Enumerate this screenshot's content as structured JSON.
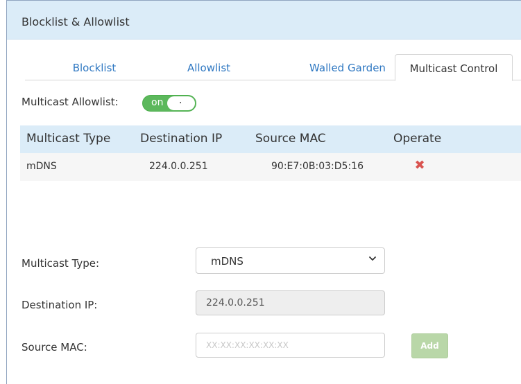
{
  "panel": {
    "title": "Blocklist & Allowlist"
  },
  "tabs": [
    {
      "label": "Blocklist",
      "active": false
    },
    {
      "label": "Allowlist",
      "active": false
    },
    {
      "label": "Walled Garden",
      "active": false
    },
    {
      "label": "Multicast Control",
      "active": true
    }
  ],
  "multicast_allowlist": {
    "label": "Multicast Allowlist:",
    "state": "on",
    "knob": "."
  },
  "table": {
    "headers": [
      "Multicast Type",
      "Destination IP",
      "Source MAC",
      "Operate"
    ],
    "rows": [
      {
        "type": "mDNS",
        "destination_ip": "224.0.0.251",
        "source_mac": "90:E7:0B:03:D5:16",
        "operate_icon": "delete-icon"
      }
    ]
  },
  "form": {
    "multicast_type_label": "Multicast Type:",
    "multicast_type_value": "mDNS",
    "destination_ip_label": "Destination IP:",
    "destination_ip_value": "224.0.0.251",
    "source_mac_label": "Source MAC:",
    "source_mac_placeholder": "XX:XX:XX:XX:XX:XX",
    "add_label": "Add"
  },
  "colors": {
    "header_bg": "#dbecf8",
    "tab_link": "#2f78c2",
    "toggle_on": "#5cb85c",
    "delete": "#d9534f",
    "add_button": "#b9d7a8"
  }
}
